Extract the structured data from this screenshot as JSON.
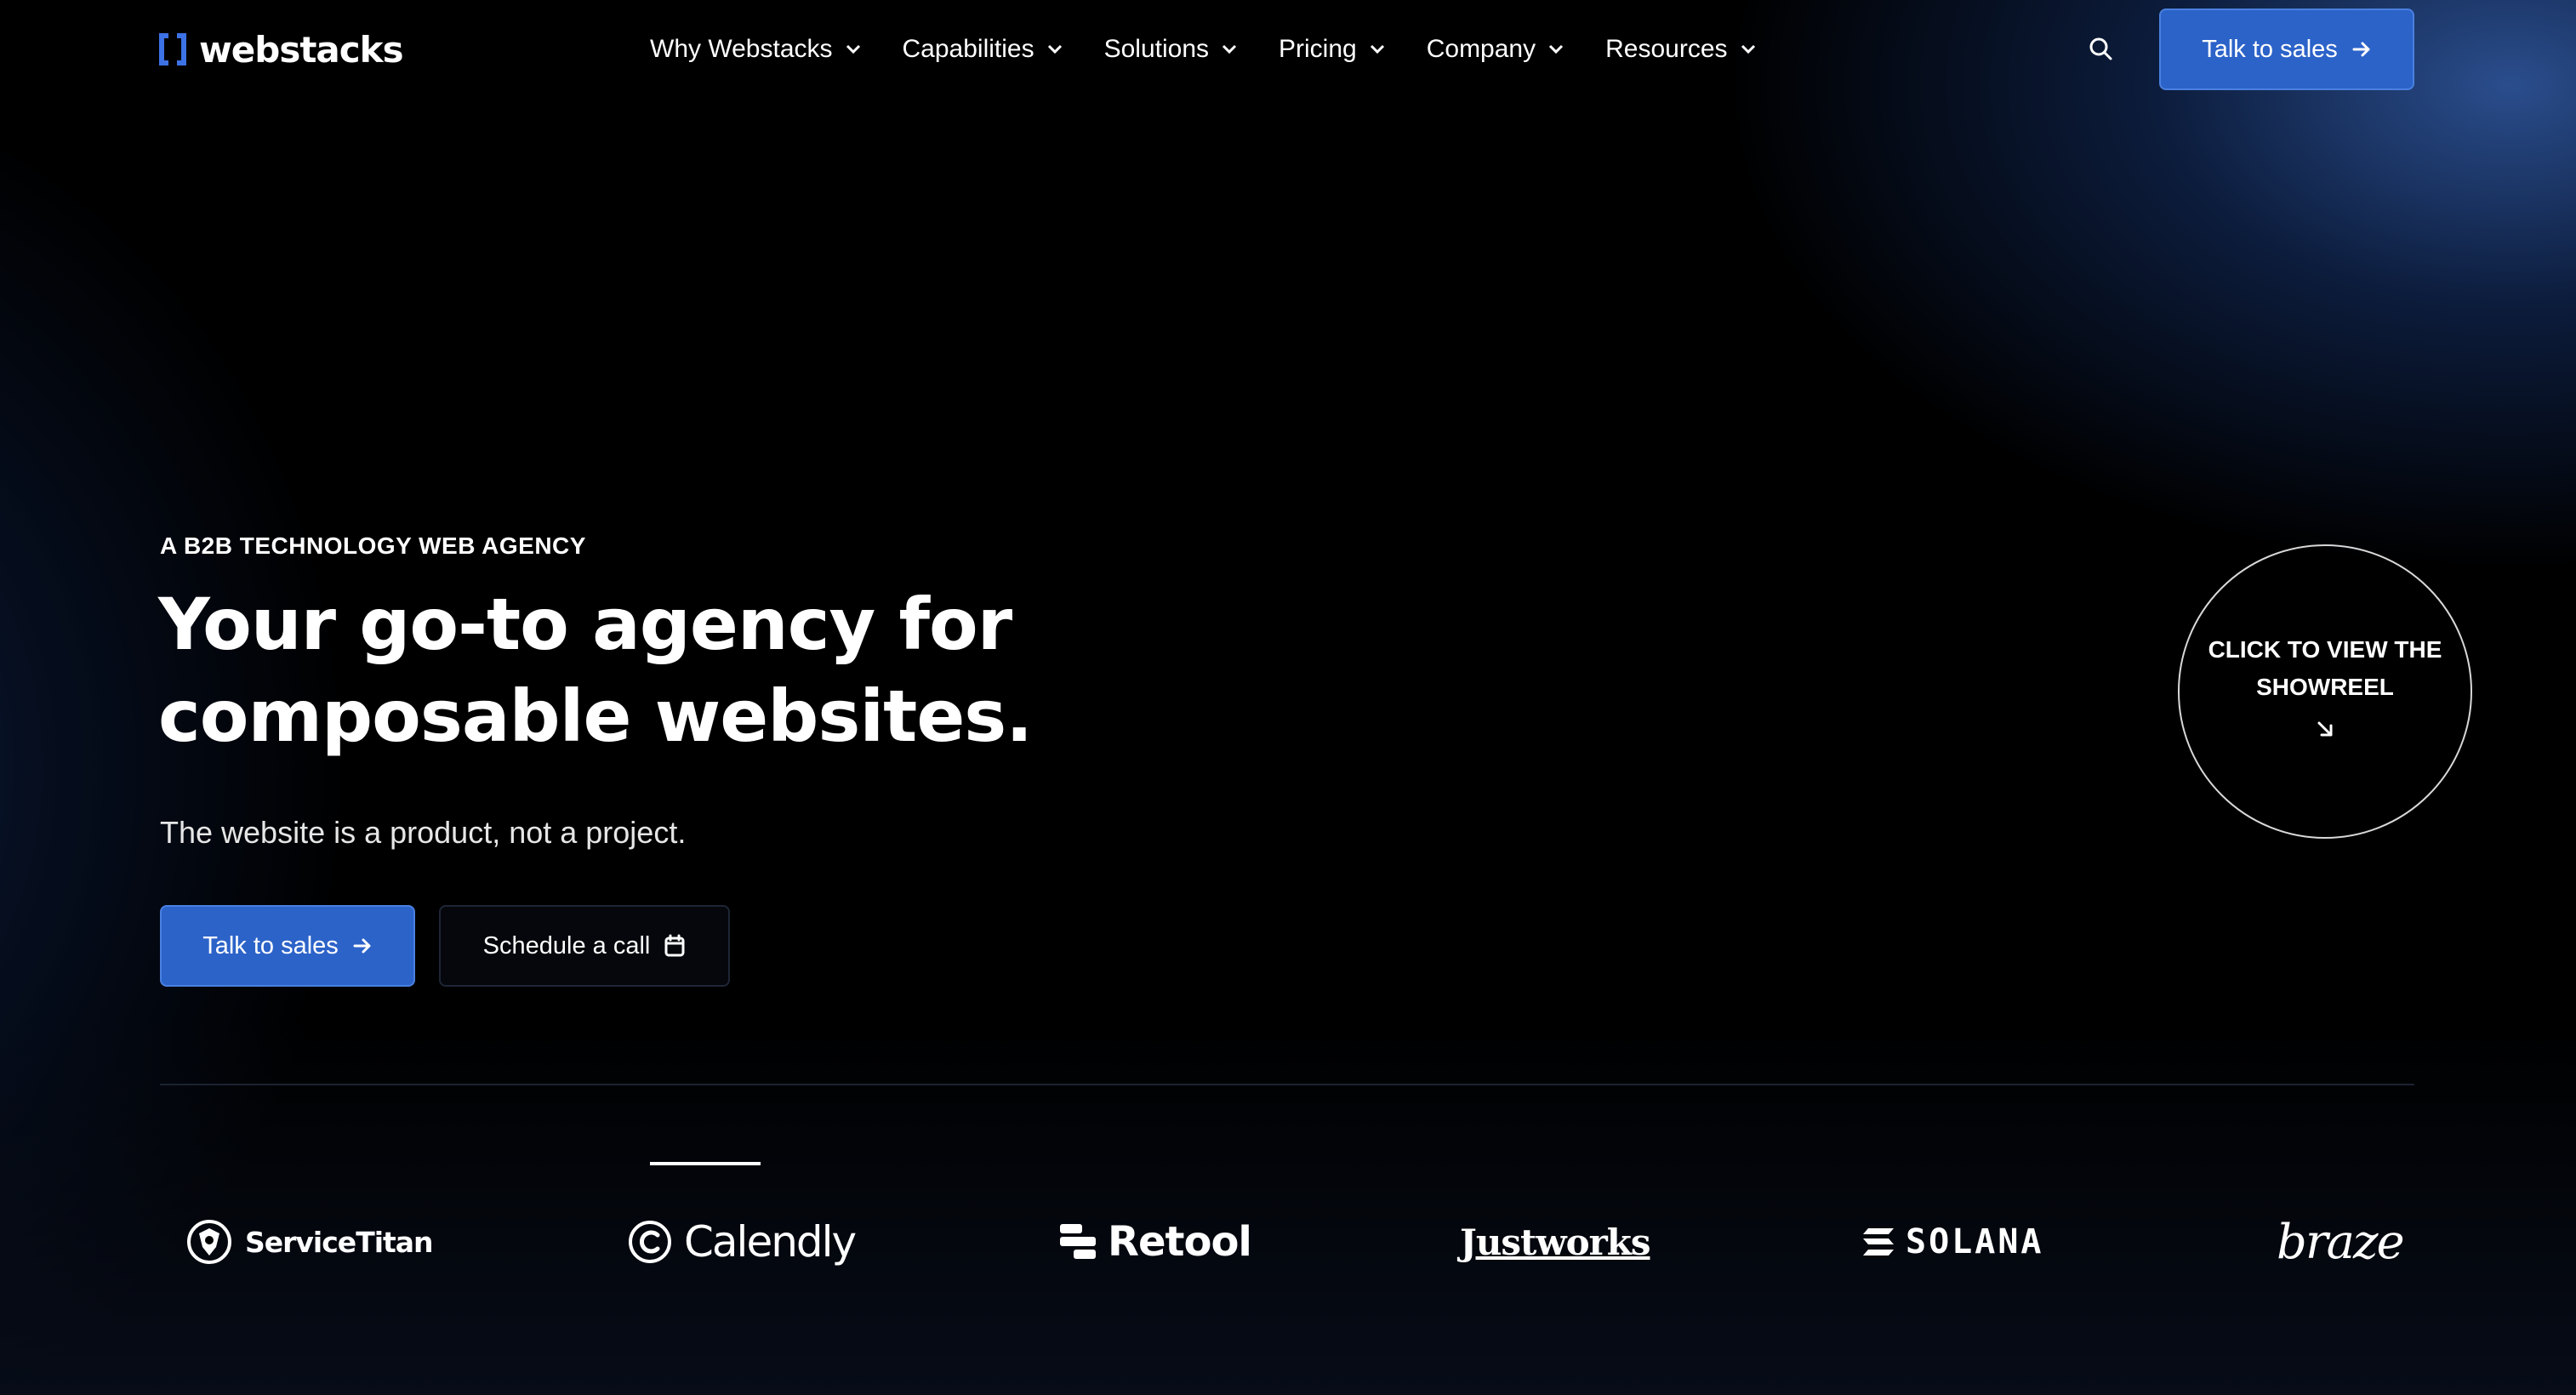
{
  "brand": {
    "name": "webstacks",
    "accent_color": "#2c63c9",
    "mark_color": "#3c72e6"
  },
  "nav": {
    "items": [
      {
        "label": "Why Webstacks",
        "icon": "chevron-down-icon"
      },
      {
        "label": "Capabilities",
        "icon": "chevron-down-icon"
      },
      {
        "label": "Solutions",
        "icon": "chevron-down-icon"
      },
      {
        "label": "Pricing",
        "icon": "chevron-down-icon"
      },
      {
        "label": "Company",
        "icon": "chevron-down-icon"
      },
      {
        "label": "Resources",
        "icon": "chevron-down-icon"
      }
    ],
    "search_icon": "search-icon",
    "cta_label": "Talk to sales",
    "cta_icon": "arrow-right-icon"
  },
  "hero": {
    "eyebrow": "A B2B TECHNOLOGY WEB AGENCY",
    "headline_line1": "Your go-to agency for",
    "headline_line2": "composable websites.",
    "subline": "The website is a product, not a project.",
    "primary_cta": "Talk to sales",
    "secondary_cta": "Schedule a call",
    "secondary_icon": "calendar-icon",
    "showreel_text": "CLICK TO VIEW THE SHOWREEL",
    "showreel_icon": "arrow-down-right-icon"
  },
  "clients": {
    "logos": [
      "ServiceTitan",
      "Calendly",
      "Retool",
      "Justworks",
      "SOLANA",
      "braze"
    ]
  }
}
